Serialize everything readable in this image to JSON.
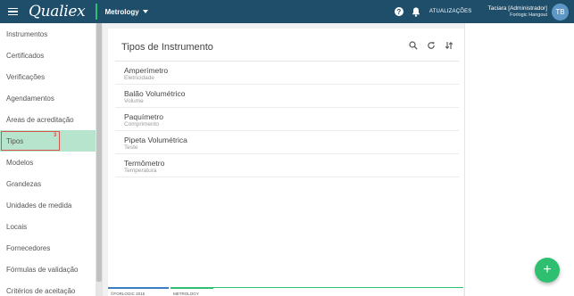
{
  "header": {
    "logo": "Qualiex",
    "module": "Metrology",
    "help_icon": "?",
    "updates": "ATUALIZAÇÕES",
    "user_name": "Taciara [Administrador]",
    "user_org": "Forlogic Hangout",
    "avatar": "TB"
  },
  "sidebar": {
    "items": [
      {
        "label": "Instrumentos"
      },
      {
        "label": "Certificados"
      },
      {
        "label": "Verificações"
      },
      {
        "label": "Agendamentos"
      },
      {
        "label": "Áreas de acreditação"
      },
      {
        "label": "Tipos",
        "badge": "3"
      },
      {
        "label": "Modelos"
      },
      {
        "label": "Grandezas"
      },
      {
        "label": "Unidades de medida"
      },
      {
        "label": "Locais"
      },
      {
        "label": "Fornecedores"
      },
      {
        "label": "Fórmulas de validação"
      },
      {
        "label": "Critérios de aceitação"
      }
    ]
  },
  "main": {
    "title": "Tipos de Instrumento",
    "rows": [
      {
        "title": "Amperímetro",
        "subtitle": "Eletricidade"
      },
      {
        "title": "Balão Volumétrico",
        "subtitle": "Volume"
      },
      {
        "title": "Paquímetro",
        "subtitle": "Comprimento"
      },
      {
        "title": "Pipeta Volumétrica",
        "subtitle": "Teste"
      },
      {
        "title": "Termômetro",
        "subtitle": "Temperatura"
      }
    ]
  },
  "footer": {
    "tab1": "©FORLOGIC 2015",
    "tab2": "METROLOGY"
  },
  "fab": {
    "label": "+"
  },
  "colors": {
    "topbar": "#1f4e6b",
    "accent": "#2fbf71",
    "active_item": "#b7e4cd",
    "avatar": "#5e97c6"
  }
}
